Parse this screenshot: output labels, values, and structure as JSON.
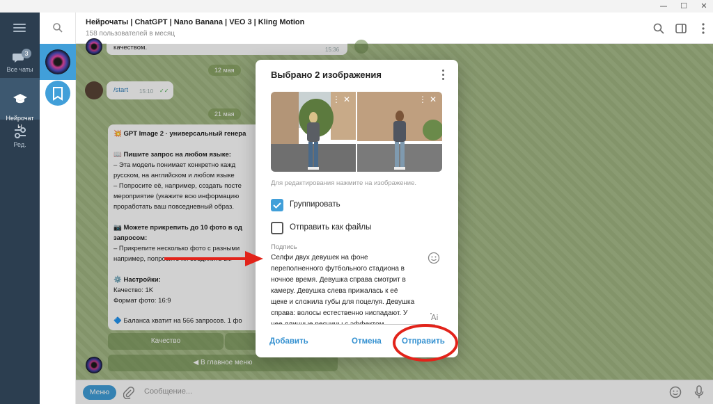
{
  "window": {
    "controls": [
      "—",
      "☐",
      "✕"
    ]
  },
  "rail": {
    "folders": [
      {
        "label": "Все чаты",
        "icon": "chat-bubbles-icon",
        "badge": "3"
      },
      {
        "label": "Нейрочат\nы",
        "icon": "graduation-cap-icon",
        "active": true
      },
      {
        "label": "Ред.",
        "icon": "sliders-icon"
      }
    ]
  },
  "header": {
    "title": "Нейрочаты | ChatGPT | Nano Banana | VEO 3 | Kling Motion",
    "subtitle": "158 пользователей в месяц"
  },
  "chat": {
    "top_message": {
      "text": "качеством.",
      "time": "15:36"
    },
    "date1": "12 мая",
    "start_message": {
      "text": "/start",
      "time": "15:10"
    },
    "date2": "21 мая",
    "bot_message": {
      "lines": [
        "💥 GPT Image 2 · универсальный генера",
        "",
        "📖 Пишите запрос на любом языке:",
        "– Эта модель понимает конкретно кажд",
        "русском, на английском и любом языке",
        "– Попросите её, например, создать посте",
        "мероприятие (укажите всю информацию",
        "проработать ваш повседневный образ.",
        "",
        "📷 Можете прикрепить до 10 фото в од",
        "запросом:",
        "– Прикрепите несколько фото с разными",
        "например, попросите их соединить вм",
        "",
        "⚙️ Настройки:",
        "Качество: 1K",
        "Формат фото: 16:9",
        "",
        "🔷 Баланса хватит на 566 запросов. 1 фо"
      ]
    },
    "keyboard": {
      "quality": "Качество",
      "back": "◀ В главное меню"
    }
  },
  "composer": {
    "menu_label": "Меню",
    "placeholder": "Сообщение..."
  },
  "modal": {
    "title": "Выбрано 2 изображения",
    "edit_hint": "Для редактирования нажмите на изображение.",
    "group_label": "Группировать",
    "group_checked": true,
    "files_label": "Отправить как файлы",
    "files_checked": false,
    "caption_label": "Подпись",
    "caption_lines": [
      "Селфи двух девушек на фоне",
      "переполненного футбольного стадиона в",
      "ночное время. Девушка справа смотрит в",
      "камеру. Девушка слева прижалась к её",
      "щеке и сложила губы для поцелуя. Девушка",
      "справа: волосы естественно ниспадают. У",
      "нее длинные ресницы с эффектом"
    ],
    "add_label": "Добавить",
    "cancel_label": "Отмена",
    "send_label": "Отправить"
  },
  "colors": {
    "accent": "#419fd9",
    "rail_bg": "#2c3e50",
    "chat_bg": "#a5bb86",
    "annotation": "#e2231a"
  }
}
